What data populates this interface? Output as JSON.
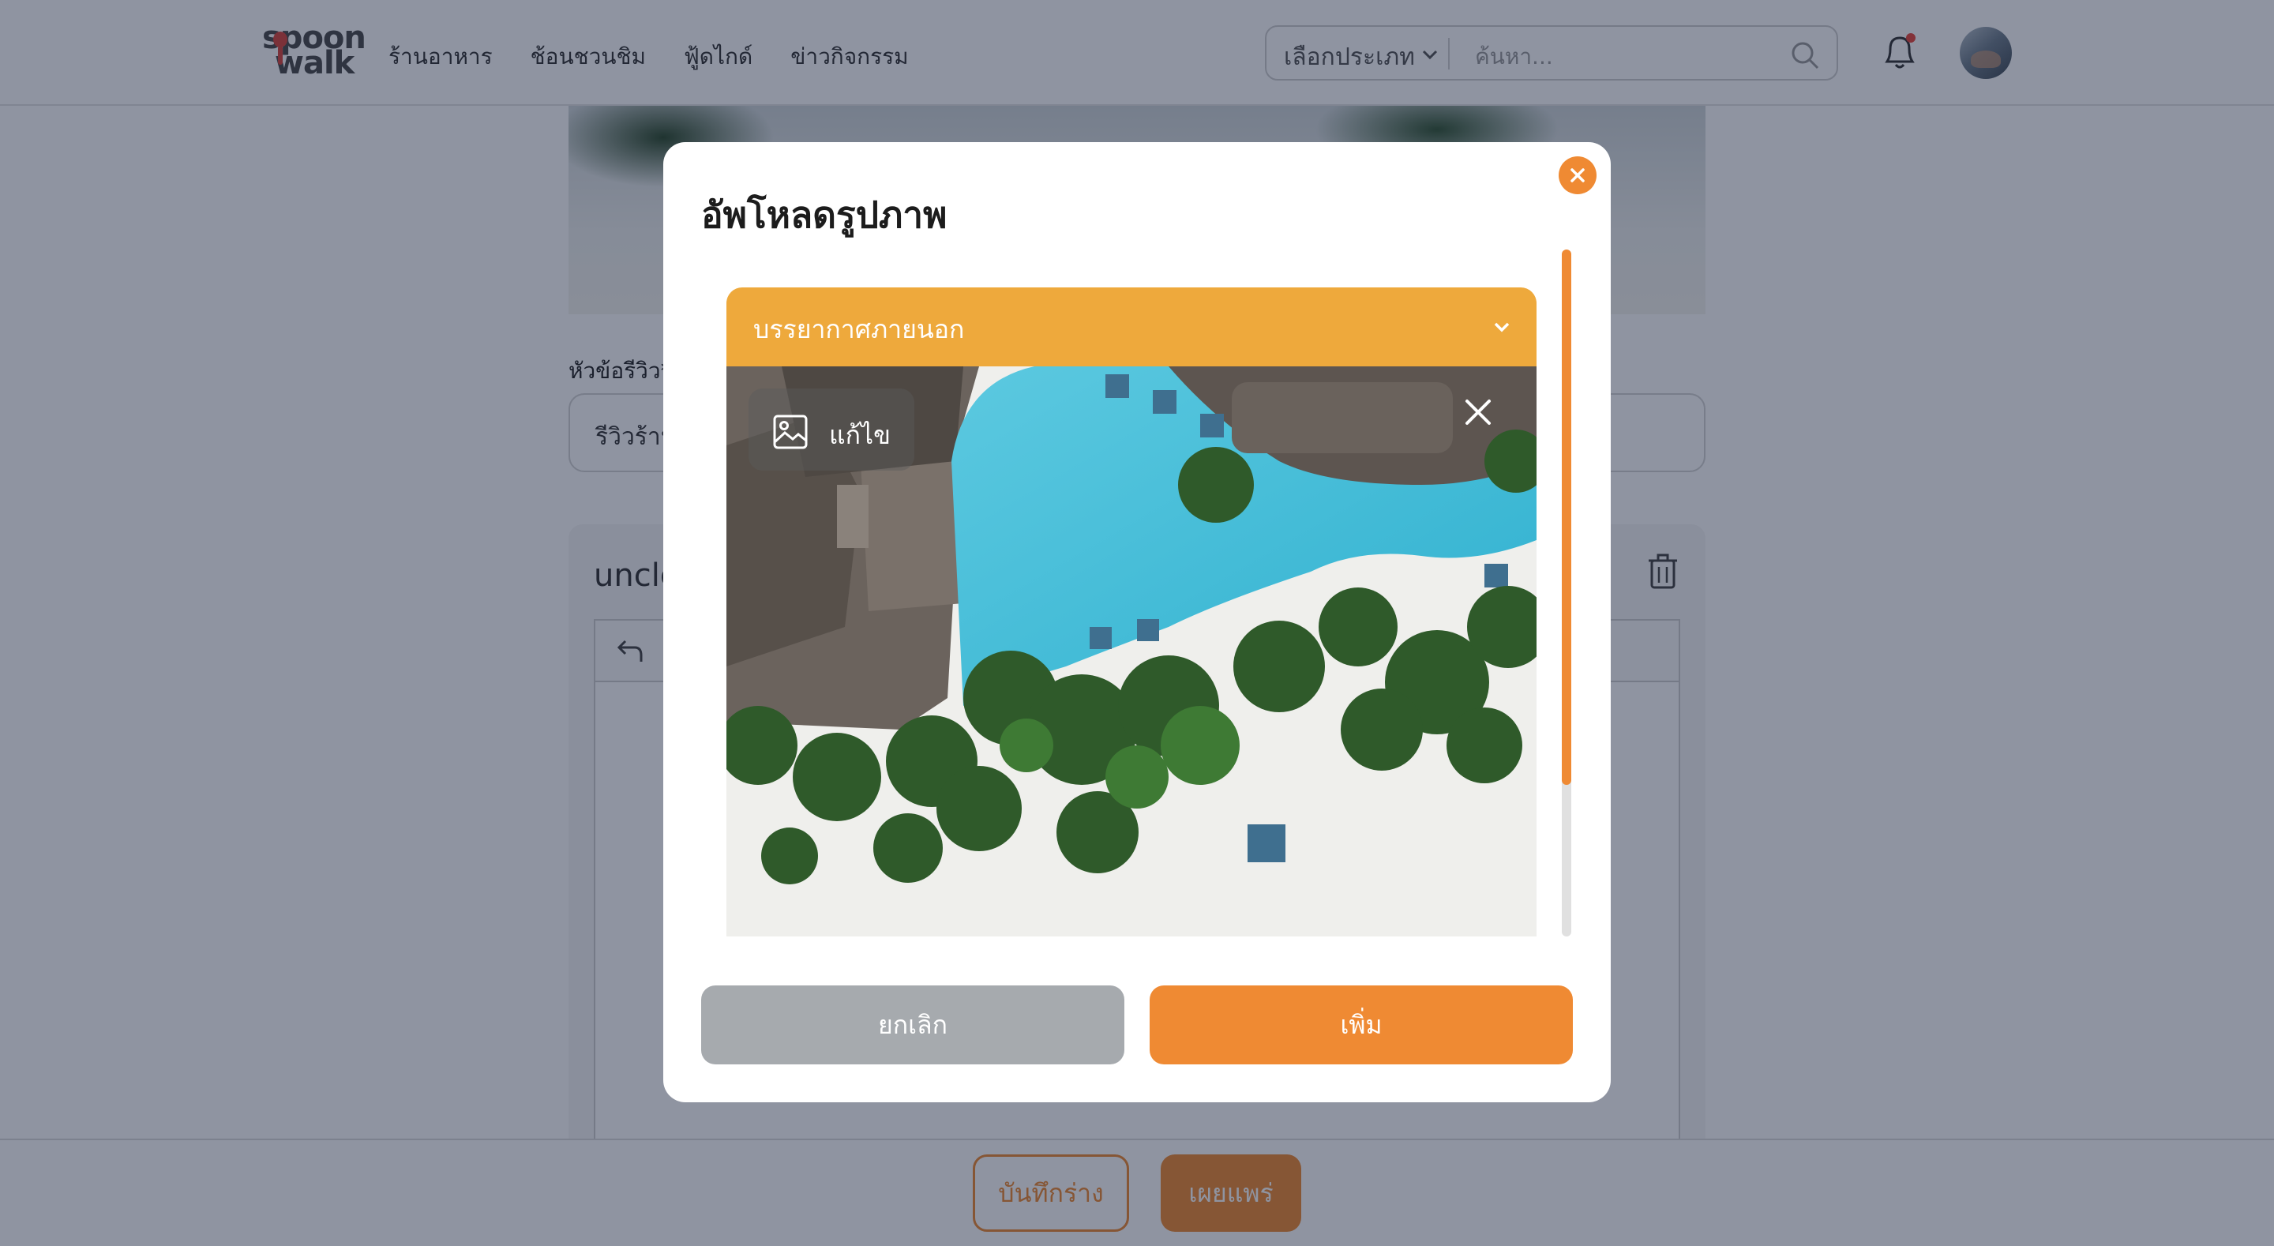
{
  "header": {
    "logo": {
      "line1": "spoon",
      "line2": "walk"
    },
    "nav": [
      {
        "label": "ร้านอาหาร"
      },
      {
        "label": "ช้อนชวนชิม"
      },
      {
        "label": "ฟู้ดไกด์"
      },
      {
        "label": "ข่าวกิจกรรม"
      }
    ],
    "search": {
      "category_label": "เลือกประเภท",
      "placeholder": "ค้นหา..."
    }
  },
  "form": {
    "title_label": "หัวข้อรีวิว*",
    "title_value": "รีวิวร้าน",
    "section_title": "uncle"
  },
  "footer": {
    "draft_label": "บันทึกร่าง",
    "publish_label": "เผยแพร่"
  },
  "modal": {
    "title": "อัพโหลดรูปภาพ",
    "category_selected": "บรรยากาศภายนอก",
    "edit_label": "แก้ไข",
    "cancel_label": "ยกเลิก",
    "add_label": "เพิ่ม"
  },
  "colors": {
    "accent": "#ef8a33",
    "accordion": "#eea93c",
    "cancel": "#a6aaae",
    "overlay": "rgba(17,28,56,0.47)"
  },
  "icons": [
    "search-icon",
    "chevron-down-icon",
    "bell-icon",
    "close-icon",
    "image-icon",
    "trash-icon",
    "undo-icon"
  ]
}
